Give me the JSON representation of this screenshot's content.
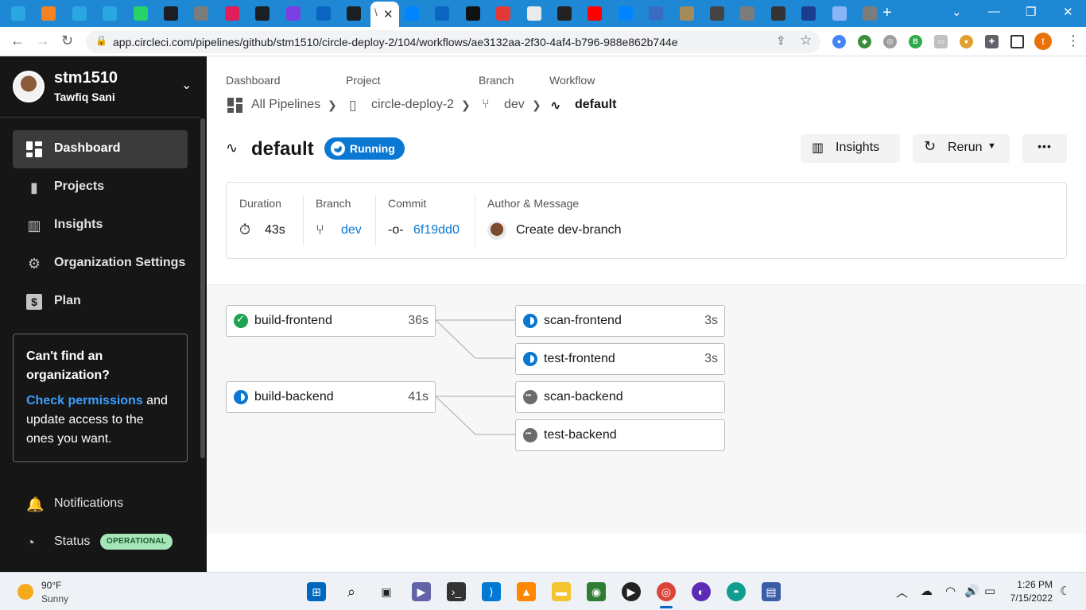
{
  "browser": {
    "active_tab_letter": "\\",
    "url": "app.circleci.com/pipelines/github/stm1510/circle-deploy-2/104/workflows/ae3132aa-2f30-4af4-b796-988e862b744e",
    "profile_initial": "t",
    "tab_icons": [
      {
        "icon": "app-icon",
        "color": "#2aa7e0"
      },
      {
        "icon": "box-icon",
        "color": "#f58220"
      },
      {
        "icon": "app-icon",
        "color": "#2aa7e0"
      },
      {
        "icon": "app-icon",
        "color": "#2aa7e0"
      },
      {
        "icon": "whatsapp-icon",
        "color": "#25d366"
      },
      {
        "icon": "github-icon",
        "color": "#1b1f23"
      },
      {
        "icon": "globe-icon",
        "color": "#7c7c7c"
      },
      {
        "icon": "slack-icon",
        "color": "#e01e5a"
      },
      {
        "icon": "github-icon",
        "color": "#1b1f23"
      },
      {
        "icon": "u-icon",
        "color": "#7b3fe4"
      },
      {
        "icon": "linkedin-icon",
        "color": "#0a66c2"
      },
      {
        "icon": "github-icon",
        "color": "#1b1f23"
      }
    ],
    "tab_icons_right": [
      {
        "icon": "messenger-icon",
        "color": "#0084ff"
      },
      {
        "icon": "linkedin-icon",
        "color": "#0a66c2"
      },
      {
        "icon": "l-icon",
        "color": "#111"
      },
      {
        "icon": "s-icon",
        "color": "#e53935"
      },
      {
        "icon": "doc-icon",
        "color": "#e8eaed"
      },
      {
        "icon": "as-icon",
        "color": "#222"
      },
      {
        "icon": "youtube-icon",
        "color": "#ff0000"
      },
      {
        "icon": "messenger-icon",
        "color": "#0084ff"
      },
      {
        "icon": "globe-icon",
        "color": "#3b6cc4"
      },
      {
        "icon": "pen-icon",
        "color": "#a58a5a"
      },
      {
        "icon": "reader-icon",
        "color": "#444"
      },
      {
        "icon": "globe-icon",
        "color": "#7c7c7c"
      },
      {
        "icon": "hat-icon",
        "color": "#333"
      },
      {
        "icon": "star-icon",
        "color": "#1b3c8f"
      },
      {
        "icon": "flake-icon",
        "color": "#8ab4f8"
      },
      {
        "icon": "globe-icon",
        "color": "#7c7c7c"
      }
    ]
  },
  "sidebar": {
    "username": "stm1510",
    "fullname": "Tawfiq Sani",
    "items": [
      {
        "label": "Dashboard",
        "icon": "dashboard-icon",
        "active": true
      },
      {
        "label": "Projects",
        "icon": "book-icon",
        "active": false
      },
      {
        "label": "Insights",
        "icon": "chart-icon",
        "active": false
      },
      {
        "label": "Organization Settings",
        "icon": "gear-icon",
        "active": false
      },
      {
        "label": "Plan",
        "icon": "dollar-icon",
        "active": false
      }
    ],
    "org_box": {
      "title": "Can't find an organization?",
      "link": "Check permissions",
      "rest": " and update access to the ones you want."
    },
    "notifications_label": "Notifications",
    "status_label": "Status",
    "status_badge": "OPERATIONAL"
  },
  "breadcrumb": {
    "heads": [
      "Dashboard",
      "Project",
      "Branch",
      "Workflow"
    ],
    "values": [
      "All Pipelines",
      "circle-deploy-2",
      "dev",
      "default"
    ]
  },
  "workflow": {
    "title": "default",
    "status": "Running",
    "insights_label": "Insights",
    "rerun_label": "Rerun",
    "more_label": "•••"
  },
  "info": {
    "duration_head": "Duration",
    "duration": "43s",
    "branch_head": "Branch",
    "branch": "dev",
    "commit_head": "Commit",
    "commit": "6f19dd0",
    "author_head": "Author & Message",
    "message": "Create dev-branch"
  },
  "jobs": {
    "build_frontend": {
      "name": "build-frontend",
      "time": "36s",
      "status": "success"
    },
    "build_backend": {
      "name": "build-backend",
      "time": "41s",
      "status": "running"
    },
    "scan_frontend": {
      "name": "scan-frontend",
      "time": "3s",
      "status": "running"
    },
    "test_frontend": {
      "name": "test-frontend",
      "time": "3s",
      "status": "running"
    },
    "scan_backend": {
      "name": "scan-backend",
      "time": "",
      "status": "on-hold"
    },
    "test_backend": {
      "name": "test-backend",
      "time": "",
      "status": "on-hold"
    }
  },
  "taskbar": {
    "temp": "90°F",
    "condition": "Sunny",
    "time": "1:26 PM",
    "date": "7/15/2022"
  },
  "colors": {
    "accent_blue": "#0a78d2",
    "success_green": "#1fa252",
    "sidebar_bg": "#161616"
  }
}
